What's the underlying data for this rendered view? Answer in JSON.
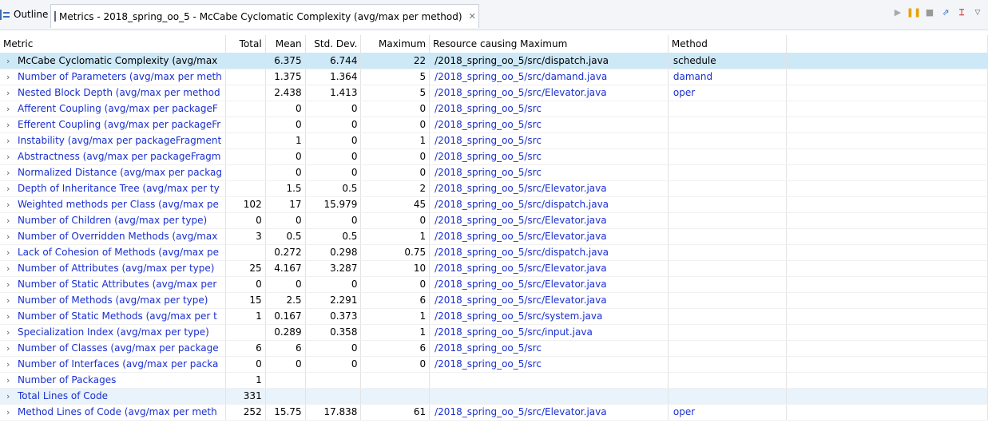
{
  "tabs": {
    "outline_label": "Outline",
    "metrics_label": "Metrics - 2018_spring_oo_5 - McCabe Cyclomatic Complexity (avg/max per method)",
    "close_glyph": "✕"
  },
  "toolbar": {
    "play_icon": "▶",
    "pause_icon": "❚❚",
    "stop_icon": "■",
    "export_icon": "⇗",
    "layout_icon": "⌶",
    "menu_icon": "▽"
  },
  "columns": [
    "Metric",
    "Total",
    "Mean",
    "Std. Dev.",
    "Maximum",
    "Resource causing Maximum",
    "Method"
  ],
  "rows": [
    {
      "metric": "McCabe Cyclomatic Complexity (avg/max",
      "total": "",
      "mean": "6.375",
      "std": "6.744",
      "max": "22",
      "resource": "/2018_spring_oo_5/src/dispatch.java",
      "method": "schedule"
    },
    {
      "metric": "Number of Parameters (avg/max per meth",
      "total": "",
      "mean": "1.375",
      "std": "1.364",
      "max": "5",
      "resource": "/2018_spring_oo_5/src/damand.java",
      "method": "damand"
    },
    {
      "metric": "Nested Block Depth (avg/max per method",
      "total": "",
      "mean": "2.438",
      "std": "1.413",
      "max": "5",
      "resource": "/2018_spring_oo_5/src/Elevator.java",
      "method": "oper"
    },
    {
      "metric": "Afferent Coupling (avg/max per packageF",
      "total": "",
      "mean": "0",
      "std": "0",
      "max": "0",
      "resource": "/2018_spring_oo_5/src",
      "method": ""
    },
    {
      "metric": "Efferent Coupling (avg/max per packageFr",
      "total": "",
      "mean": "0",
      "std": "0",
      "max": "0",
      "resource": "/2018_spring_oo_5/src",
      "method": ""
    },
    {
      "metric": "Instability (avg/max per packageFragment",
      "total": "",
      "mean": "1",
      "std": "0",
      "max": "1",
      "resource": "/2018_spring_oo_5/src",
      "method": ""
    },
    {
      "metric": "Abstractness (avg/max per packageFragm",
      "total": "",
      "mean": "0",
      "std": "0",
      "max": "0",
      "resource": "/2018_spring_oo_5/src",
      "method": ""
    },
    {
      "metric": "Normalized Distance (avg/max per packag",
      "total": "",
      "mean": "0",
      "std": "0",
      "max": "0",
      "resource": "/2018_spring_oo_5/src",
      "method": ""
    },
    {
      "metric": "Depth of Inheritance Tree (avg/max per ty",
      "total": "",
      "mean": "1.5",
      "std": "0.5",
      "max": "2",
      "resource": "/2018_spring_oo_5/src/Elevator.java",
      "method": ""
    },
    {
      "metric": "Weighted methods per Class (avg/max pe",
      "total": "102",
      "mean": "17",
      "std": "15.979",
      "max": "45",
      "resource": "/2018_spring_oo_5/src/dispatch.java",
      "method": ""
    },
    {
      "metric": "Number of Children (avg/max per type)",
      "total": "0",
      "mean": "0",
      "std": "0",
      "max": "0",
      "resource": "/2018_spring_oo_5/src/Elevator.java",
      "method": ""
    },
    {
      "metric": "Number of Overridden Methods (avg/max",
      "total": "3",
      "mean": "0.5",
      "std": "0.5",
      "max": "1",
      "resource": "/2018_spring_oo_5/src/Elevator.java",
      "method": ""
    },
    {
      "metric": "Lack of Cohesion of Methods (avg/max pe",
      "total": "",
      "mean": "0.272",
      "std": "0.298",
      "max": "0.75",
      "resource": "/2018_spring_oo_5/src/dispatch.java",
      "method": ""
    },
    {
      "metric": "Number of Attributes (avg/max per type)",
      "total": "25",
      "mean": "4.167",
      "std": "3.287",
      "max": "10",
      "resource": "/2018_spring_oo_5/src/Elevator.java",
      "method": ""
    },
    {
      "metric": "Number of Static Attributes (avg/max per",
      "total": "0",
      "mean": "0",
      "std": "0",
      "max": "0",
      "resource": "/2018_spring_oo_5/src/Elevator.java",
      "method": ""
    },
    {
      "metric": "Number of Methods (avg/max per type)",
      "total": "15",
      "mean": "2.5",
      "std": "2.291",
      "max": "6",
      "resource": "/2018_spring_oo_5/src/Elevator.java",
      "method": ""
    },
    {
      "metric": "Number of Static Methods (avg/max per t",
      "total": "1",
      "mean": "0.167",
      "std": "0.373",
      "max": "1",
      "resource": "/2018_spring_oo_5/src/system.java",
      "method": ""
    },
    {
      "metric": "Specialization Index (avg/max per type)",
      "total": "",
      "mean": "0.289",
      "std": "0.358",
      "max": "1",
      "resource": "/2018_spring_oo_5/src/input.java",
      "method": ""
    },
    {
      "metric": "Number of Classes (avg/max per package",
      "total": "6",
      "mean": "6",
      "std": "0",
      "max": "6",
      "resource": "/2018_spring_oo_5/src",
      "method": ""
    },
    {
      "metric": "Number of Interfaces (avg/max per packa",
      "total": "0",
      "mean": "0",
      "std": "0",
      "max": "0",
      "resource": "/2018_spring_oo_5/src",
      "method": ""
    },
    {
      "metric": "Number of Packages",
      "total": "1",
      "mean": "",
      "std": "",
      "max": "",
      "resource": "",
      "method": ""
    },
    {
      "metric": "Total Lines of Code",
      "total": "331",
      "mean": "",
      "std": "",
      "max": "",
      "resource": "",
      "method": ""
    },
    {
      "metric": "Method Lines of Code (avg/max per meth",
      "total": "252",
      "mean": "15.75",
      "std": "17.838",
      "max": "61",
      "resource": "/2018_spring_oo_5/src/Elevator.java",
      "method": "oper"
    }
  ]
}
